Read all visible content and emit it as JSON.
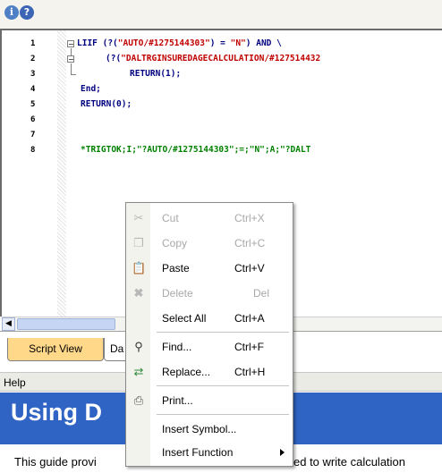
{
  "toolbar": {
    "info_icon": "info-icon",
    "help_icon": "help-icon"
  },
  "editor": {
    "line_numbers": [
      "1",
      "2",
      "3",
      "4",
      "5",
      "6",
      "7",
      "8"
    ],
    "lines": {
      "l1_a": "LIIF (?(",
      "l1_b": "\"AUTO/#1275144303\"",
      "l1_c": ") = ",
      "l1_d": "\"N\"",
      "l1_e": ") AND \\",
      "l2_a": "(?(",
      "l2_b": "\"DALTRGINSUREDAGECALCULATION/#127514432",
      "l3": "RETURN(1);",
      "l4": "End;",
      "l5": "RETURN(0);",
      "l8": "*TRIGTOK;I;\"?AUTO/#1275144303\";=;\"N\";A;\"?DALT"
    }
  },
  "tabs": {
    "script_view": "Script View",
    "data": "Da"
  },
  "help": {
    "header": "Help",
    "title": "Using D",
    "body": "This guide provi",
    "body_tail": "ed to write calculation"
  },
  "menu": {
    "items": [
      {
        "label": "Cut",
        "shortcut": "Ctrl+X",
        "icon": "scissors-icon",
        "enabled": false
      },
      {
        "label": "Copy",
        "shortcut": "Ctrl+C",
        "icon": "copy-icon",
        "enabled": false
      },
      {
        "label": "Paste",
        "shortcut": "Ctrl+V",
        "icon": "paste-icon",
        "enabled": true
      },
      {
        "label": "Delete",
        "shortcut": "Del",
        "icon": "delete-icon",
        "enabled": false
      },
      {
        "label": "Select All",
        "shortcut": "Ctrl+A",
        "icon": "",
        "enabled": true
      },
      {
        "label": "Find...",
        "shortcut": "Ctrl+F",
        "icon": "binoculars-icon",
        "enabled": true
      },
      {
        "label": "Replace...",
        "shortcut": "Ctrl+H",
        "icon": "replace-icon",
        "enabled": true
      },
      {
        "label": "Print...",
        "shortcut": "",
        "icon": "printer-icon",
        "enabled": true
      },
      {
        "label": "Insert Symbol...",
        "shortcut": "",
        "icon": "",
        "enabled": true
      },
      {
        "label": "Insert Function",
        "shortcut": "",
        "icon": "",
        "enabled": true
      }
    ]
  },
  "colors": {
    "banner": "#2f64c4",
    "tab_active": "#ffd88a",
    "keyword": "#000080",
    "string": "#c00000",
    "comment": "#008000"
  }
}
